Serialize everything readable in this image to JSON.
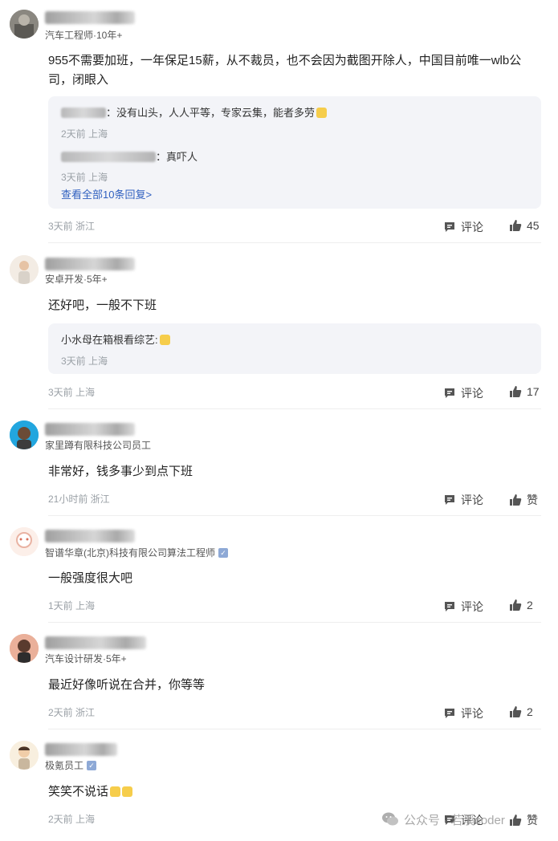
{
  "comments": [
    {
      "meta": "汽车工程师·10年+",
      "text": "955不需要加班，一年保足15薪，从不裁员，也不会因为截图开除人，中国目前唯一wlb公司，闭眼入",
      "replies": [
        {
          "text": "：没有山头，人人平等，专家云集，能者多劳",
          "time": "2天前 上海"
        },
        {
          "text": "：真吓人",
          "time": "3天前 上海"
        }
      ],
      "more": "查看全部10条回复>",
      "time": "3天前 浙江",
      "comment_label": "评论",
      "likes": "45"
    },
    {
      "meta": "安卓开发·5年+",
      "text": "还好吧，一般不下班",
      "reply": {
        "author": "小水母在箱根看综艺:",
        "time": "3天前 上海"
      },
      "time": "3天前 上海",
      "comment_label": "评论",
      "likes": "17"
    },
    {
      "meta": "家里蹲有限科技公司员工",
      "text": "非常好，钱多事少到点下班",
      "time": "21小时前 浙江",
      "comment_label": "评论",
      "likes": "赞"
    },
    {
      "meta": "智谱华章(北京)科技有限公司算法工程师",
      "text": "一般强度很大吧",
      "time": "1天前 上海",
      "comment_label": "评论",
      "likes": "2"
    },
    {
      "meta": "汽车设计研发·5年+",
      "text": "最近好像听说在合并，你等等",
      "time": "2天前 浙江",
      "comment_label": "评论",
      "likes": "2"
    },
    {
      "meta": "极氪员工",
      "text": "笑笑不说话",
      "time": "2天前 上海",
      "comment_label": "评论",
      "likes": "赞"
    }
  ],
  "watermark": "公众号 · 若溪coder",
  "colors": {
    "link": "#2f5fbf",
    "reply_bg": "#f3f4f8",
    "muted": "#9aa0a6"
  }
}
